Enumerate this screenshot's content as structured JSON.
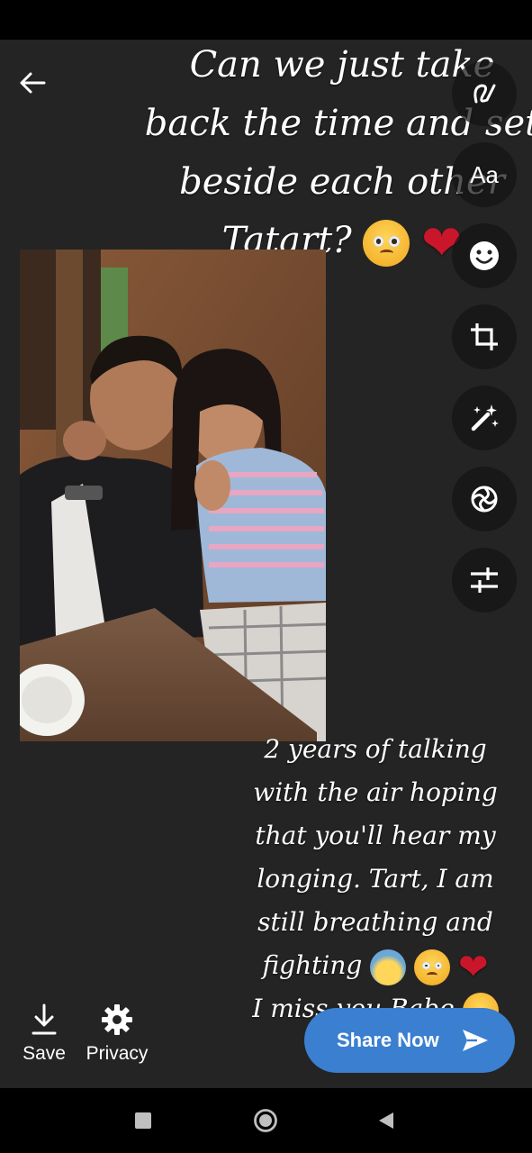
{
  "caption_top": {
    "lines": [
      "Can we just take",
      "back the time and set",
      "beside each other",
      "Tatart?"
    ]
  },
  "caption_bottom": {
    "lines": [
      "2 years of talking",
      "with the air hoping",
      "that you'll hear my",
      "longing. Tart, I am",
      "still breathing and",
      "fighting",
      "I miss you Babe"
    ]
  },
  "toolbar": {
    "tools": [
      {
        "name": "draw",
        "icon": "squiggle-pen-icon"
      },
      {
        "name": "text",
        "icon": "Aa"
      },
      {
        "name": "sticker",
        "icon": "smiley-icon"
      },
      {
        "name": "crop",
        "icon": "crop-icon"
      },
      {
        "name": "magic",
        "icon": "magic-wand-icon"
      },
      {
        "name": "filter",
        "icon": "filter-icon"
      },
      {
        "name": "adjust",
        "icon": "sliders-icon"
      }
    ]
  },
  "actions": {
    "save_label": "Save",
    "privacy_label": "Privacy",
    "share_label": "Share Now"
  },
  "colors": {
    "background": "#242424",
    "share_button": "#3a7fd0",
    "tool_button": "#141414"
  }
}
